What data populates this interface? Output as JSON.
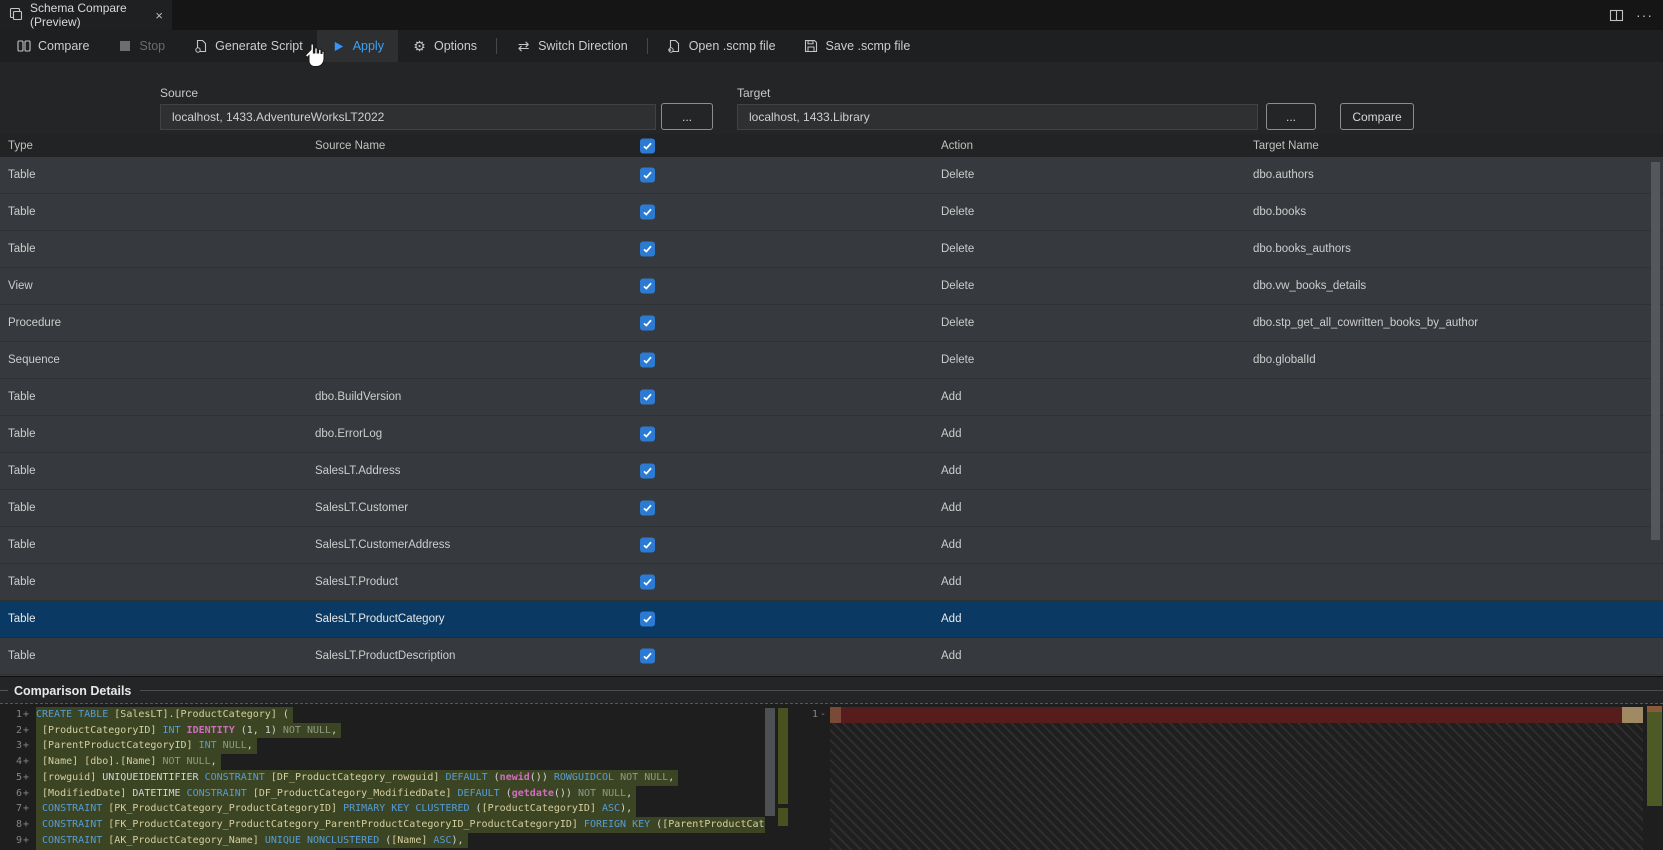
{
  "tab": {
    "title": "Schema Compare (Preview)",
    "close_glyph": "×"
  },
  "window_actions": {
    "more_glyph": "···"
  },
  "toolbar": {
    "items": [
      {
        "id": "compare",
        "label": "Compare",
        "icon": "compare-icon"
      },
      {
        "id": "stop",
        "label": "Stop",
        "icon": "stop-icon",
        "disabled": true
      },
      {
        "id": "generate-script",
        "label": "Generate Script",
        "icon": "script-icon"
      },
      {
        "id": "apply",
        "label": "Apply",
        "icon": "play-icon",
        "active": true
      },
      {
        "id": "options",
        "label": "Options",
        "icon": "gear-icon"
      },
      {
        "id": "switch-direction",
        "label": "Switch Direction",
        "icon": "switch-icon",
        "sep_before": true
      },
      {
        "id": "open-scmp",
        "label": "Open .scmp file",
        "icon": "open-file-icon",
        "sep_before": true
      },
      {
        "id": "save-scmp",
        "label": "Save .scmp file",
        "icon": "save-icon"
      }
    ]
  },
  "connections": {
    "source_label": "Source",
    "source_value": "localhost, 1433.AdventureWorksLT2022",
    "target_label": "Target",
    "target_value": "localhost, 1433.Library",
    "browse_label": "...",
    "compare_button": "Compare"
  },
  "table": {
    "columns": [
      "Type",
      "Source Name",
      "Action",
      "Target Name"
    ],
    "rows": [
      {
        "type": "Table",
        "source": "",
        "checked": true,
        "action": "Delete",
        "target": "dbo.authors"
      },
      {
        "type": "Table",
        "source": "",
        "checked": true,
        "action": "Delete",
        "target": "dbo.books"
      },
      {
        "type": "Table",
        "source": "",
        "checked": true,
        "action": "Delete",
        "target": "dbo.books_authors"
      },
      {
        "type": "View",
        "source": "",
        "checked": true,
        "action": "Delete",
        "target": "dbo.vw_books_details"
      },
      {
        "type": "Procedure",
        "source": "",
        "checked": true,
        "action": "Delete",
        "target": "dbo.stp_get_all_cowritten_books_by_author"
      },
      {
        "type": "Sequence",
        "source": "",
        "checked": true,
        "action": "Delete",
        "target": "dbo.globalId"
      },
      {
        "type": "Table",
        "source": "dbo.BuildVersion",
        "checked": true,
        "action": "Add",
        "target": ""
      },
      {
        "type": "Table",
        "source": "dbo.ErrorLog",
        "checked": true,
        "action": "Add",
        "target": ""
      },
      {
        "type": "Table",
        "source": "SalesLT.Address",
        "checked": true,
        "action": "Add",
        "target": ""
      },
      {
        "type": "Table",
        "source": "SalesLT.Customer",
        "checked": true,
        "action": "Add",
        "target": ""
      },
      {
        "type": "Table",
        "source": "SalesLT.CustomerAddress",
        "checked": true,
        "action": "Add",
        "target": ""
      },
      {
        "type": "Table",
        "source": "SalesLT.Product",
        "checked": true,
        "action": "Add",
        "target": ""
      },
      {
        "type": "Table",
        "source": "SalesLT.ProductCategory",
        "checked": true,
        "action": "Add",
        "target": "",
        "selected": true
      },
      {
        "type": "Table",
        "source": "SalesLT.ProductDescription",
        "checked": true,
        "action": "Add",
        "target": ""
      }
    ]
  },
  "details": {
    "title": "Comparison Details",
    "left_lines": [
      {
        "num": "1",
        "sign": "+",
        "tokens": [
          {
            "t": "CREATE TABLE",
            "c": "kw"
          },
          {
            "t": " ",
            "c": "pl"
          },
          {
            "t": "[SalesLT].[ProductCategory]",
            "c": "id"
          },
          {
            "t": " (",
            "c": "pl"
          }
        ]
      },
      {
        "num": "2",
        "sign": "+",
        "tokens": [
          {
            "t": " ",
            "c": "pl"
          },
          {
            "t": "[ProductCategoryID]",
            "c": "id"
          },
          {
            "t": " ",
            "c": "pl"
          },
          {
            "t": "INT",
            "c": "kw"
          },
          {
            "t": " ",
            "c": "pl"
          },
          {
            "t": "IDENTITY",
            "c": "fn"
          },
          {
            "t": " (1, 1) ",
            "c": "pl"
          },
          {
            "t": "NOT NULL",
            "c": "dim"
          },
          {
            "t": ",",
            "c": "pl"
          }
        ]
      },
      {
        "num": "3",
        "sign": "+",
        "tokens": [
          {
            "t": " ",
            "c": "pl"
          },
          {
            "t": "[ParentProductCategoryID]",
            "c": "id"
          },
          {
            "t": " ",
            "c": "pl"
          },
          {
            "t": "INT",
            "c": "kw"
          },
          {
            "t": " ",
            "c": "pl"
          },
          {
            "t": "NULL",
            "c": "dim"
          },
          {
            "t": ",",
            "c": "pl"
          }
        ]
      },
      {
        "num": "4",
        "sign": "+",
        "tokens": [
          {
            "t": " ",
            "c": "pl"
          },
          {
            "t": "[Name]",
            "c": "id"
          },
          {
            "t": " ",
            "c": "pl"
          },
          {
            "t": "[dbo].[Name]",
            "c": "id"
          },
          {
            "t": " ",
            "c": "pl"
          },
          {
            "t": "NOT NULL",
            "c": "dim"
          },
          {
            "t": ",",
            "c": "pl"
          }
        ]
      },
      {
        "num": "5",
        "sign": "+",
        "tokens": [
          {
            "t": " ",
            "c": "pl"
          },
          {
            "t": "[rowguid]",
            "c": "id"
          },
          {
            "t": " ",
            "c": "pl"
          },
          {
            "t": "UNIQUEIDENTIFIER",
            "c": "pl"
          },
          {
            "t": " ",
            "c": "pl"
          },
          {
            "t": "CONSTRAINT",
            "c": "kw"
          },
          {
            "t": " ",
            "c": "pl"
          },
          {
            "t": "[DF_ProductCategory_rowguid]",
            "c": "id"
          },
          {
            "t": " ",
            "c": "pl"
          },
          {
            "t": "DEFAULT",
            "c": "kw"
          },
          {
            "t": " (",
            "c": "pl"
          },
          {
            "t": "newid",
            "c": "fn"
          },
          {
            "t": "()) ",
            "c": "pl"
          },
          {
            "t": "ROWGUIDCOL",
            "c": "kw"
          },
          {
            "t": " ",
            "c": "pl"
          },
          {
            "t": "NOT NULL",
            "c": "dim"
          },
          {
            "t": ",",
            "c": "pl"
          }
        ]
      },
      {
        "num": "6",
        "sign": "+",
        "tokens": [
          {
            "t": " ",
            "c": "pl"
          },
          {
            "t": "[ModifiedDate]",
            "c": "id"
          },
          {
            "t": " ",
            "c": "pl"
          },
          {
            "t": "DATETIME",
            "c": "pl"
          },
          {
            "t": " ",
            "c": "pl"
          },
          {
            "t": "CONSTRAINT",
            "c": "kw"
          },
          {
            "t": " ",
            "c": "pl"
          },
          {
            "t": "[DF_ProductCategory_ModifiedDate]",
            "c": "id"
          },
          {
            "t": " ",
            "c": "pl"
          },
          {
            "t": "DEFAULT",
            "c": "kw"
          },
          {
            "t": " (",
            "c": "pl"
          },
          {
            "t": "getdate",
            "c": "fn"
          },
          {
            "t": "()) ",
            "c": "pl"
          },
          {
            "t": "NOT NULL",
            "c": "dim"
          },
          {
            "t": ",",
            "c": "pl"
          }
        ]
      },
      {
        "num": "7",
        "sign": "+",
        "tokens": [
          {
            "t": " ",
            "c": "pl"
          },
          {
            "t": "CONSTRAINT",
            "c": "kw"
          },
          {
            "t": " ",
            "c": "pl"
          },
          {
            "t": "[PK_ProductCategory_ProductCategoryID]",
            "c": "id"
          },
          {
            "t": " ",
            "c": "pl"
          },
          {
            "t": "PRIMARY KEY CLUSTERED",
            "c": "kw"
          },
          {
            "t": " (",
            "c": "pl"
          },
          {
            "t": "[ProductCategoryID]",
            "c": "id"
          },
          {
            "t": " ",
            "c": "pl"
          },
          {
            "t": "ASC",
            "c": "kw"
          },
          {
            "t": "),",
            "c": "pl"
          }
        ]
      },
      {
        "num": "8",
        "sign": "+",
        "tokens": [
          {
            "t": " ",
            "c": "pl"
          },
          {
            "t": "CONSTRAINT",
            "c": "kw"
          },
          {
            "t": " ",
            "c": "pl"
          },
          {
            "t": "[FK_ProductCategory_ProductCategory_ParentProductCategoryID_ProductCategoryID]",
            "c": "id"
          },
          {
            "t": " ",
            "c": "pl"
          },
          {
            "t": "FOREIGN KEY",
            "c": "kw"
          },
          {
            "t": " (",
            "c": "pl"
          },
          {
            "t": "[ParentProductCategoryID]",
            "c": "id"
          }
        ]
      },
      {
        "num": "9",
        "sign": "+",
        "tokens": [
          {
            "t": " ",
            "c": "pl"
          },
          {
            "t": "CONSTRAINT",
            "c": "kw"
          },
          {
            "t": " ",
            "c": "pl"
          },
          {
            "t": "[AK_ProductCategory_Name]",
            "c": "id"
          },
          {
            "t": " ",
            "c": "pl"
          },
          {
            "t": "UNIQUE NONCLUSTERED",
            "c": "kw"
          },
          {
            "t": " (",
            "c": "pl"
          },
          {
            "t": "[Name]",
            "c": "id"
          },
          {
            "t": " ",
            "c": "pl"
          },
          {
            "t": "ASC",
            "c": "kw"
          },
          {
            "t": "),",
            "c": "pl"
          }
        ]
      }
    ],
    "right_lines": [
      {
        "num": "1",
        "sign": "-"
      }
    ]
  },
  "colors": {
    "accent_blue": "#3794ff",
    "checkbox_blue": "#2b7bd4",
    "selected_row": "#0a3a64",
    "added_line_bg": "#3c4523",
    "removed_line_bg": "#571d1d",
    "keyword": "#569cd6",
    "identifier": "#d6cfa0",
    "function": "#d16dc0"
  }
}
